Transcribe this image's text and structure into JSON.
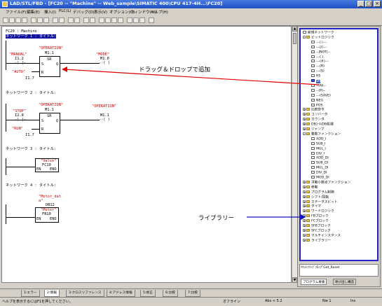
{
  "window": {
    "title": "LAD/STL/FBD - [FC20 -- \"Machine\" -- Web_sample\\SIMATIC 400\\CPU 417-4H...\\FC20]"
  },
  "menu": [
    "ファイル(F)",
    "編集(E)",
    "挿入(I)",
    "PLC(L)",
    "デバッグ(D)",
    "表示(V)",
    "オプション(O)",
    "ウィンドウ(W)",
    "ヘルプ(H)"
  ],
  "editor": {
    "block_header": "FC20 : Machine",
    "networks": [
      {
        "label": "ネットワーク 1 : タイトル:",
        "symbol_in_a": "\"MANUAL\"",
        "addr_in_a": "I1.2",
        "symbol_in_b": "\"AUTO\"",
        "addr_in_b": "I1.7",
        "sr_symbol": "\"OPERATION\"",
        "sr_addr": "M1.1",
        "sr_title": "SR",
        "pin_s": "S",
        "pin_r": "R",
        "pin_q": "Q",
        "coil_symbol": "\"MODE\"",
        "coil_addr": "M1.0"
      },
      {
        "label": "ネットワーク 2 : タイトル:",
        "symbol_in_a": "\"STOP\"",
        "addr_in_a": "I2.0",
        "symbol_in_b": "\"RUN\"",
        "addr_in_b": "I1.7",
        "sr_symbol": "\"OPERATION\"",
        "sr_addr": "M1.1",
        "sr_title": "SR",
        "pin_s": "S",
        "pin_r": "R",
        "pin_q": "Q",
        "coil_symbol": "\"OPERATION\"",
        "coil_addr": "M1.1"
      },
      {
        "label": "ネットワーク 3 : タイトル:",
        "block_symbol": "\"Valve\"",
        "block_name": "FC10",
        "pin_en": "EN",
        "pin_eno": "ENO"
      },
      {
        "label": "ネットワーク 4 : タイトル:",
        "block_symbol": "\"Motor_dat\na\"",
        "block_db": "DB12",
        "block_fb_symbol": "\"Motor\"",
        "block_name": "FB10",
        "pin_en": "EN",
        "pin_eno": "ENO"
      }
    ]
  },
  "annotations": {
    "drag_drop": "ドラッグ＆ドロップで追加",
    "library": "ライブラリー"
  },
  "catalog": {
    "tree": [
      {
        "label": "新規ネットワーク",
        "level": 0,
        "icon": "item"
      },
      {
        "label": "ビットロジック",
        "level": 0,
        "icon": "folder",
        "expand": "-"
      },
      {
        "label": "---| |---",
        "level": 1,
        "icon": "item"
      },
      {
        "label": "---|/|---",
        "level": 1,
        "icon": "item"
      },
      {
        "label": "--|NOT|--",
        "level": 1,
        "icon": "item"
      },
      {
        "label": "---( )",
        "level": 1,
        "icon": "item"
      },
      {
        "label": "---(#)---",
        "level": 1,
        "icon": "item"
      },
      {
        "label": "---(R)",
        "level": 1,
        "icon": "item"
      },
      {
        "label": "---(S)",
        "level": 1,
        "icon": "item"
      },
      {
        "label": "RS",
        "level": 1,
        "icon": "item"
      },
      {
        "label": "SR",
        "level": 1,
        "icon": "sel",
        "selected": true
      },
      {
        "label": "--(N)--",
        "level": 1,
        "icon": "item"
      },
      {
        "label": "--(P)--",
        "level": 1,
        "icon": "item"
      },
      {
        "label": "---(SAVE)",
        "level": 1,
        "icon": "item"
      },
      {
        "label": "NEG",
        "level": 1,
        "icon": "item"
      },
      {
        "label": "POS",
        "level": 1,
        "icon": "item"
      },
      {
        "label": "比較命令",
        "level": 0,
        "icon": "folder",
        "expand": "+"
      },
      {
        "label": "コンバータ",
        "level": 0,
        "icon": "folder",
        "expand": "+"
      },
      {
        "label": "カウンタ",
        "level": 0,
        "icon": "folder",
        "expand": "+"
      },
      {
        "label": "DBｺｰﾙ/DB処理",
        "level": 0,
        "icon": "folder",
        "expand": "+"
      },
      {
        "label": "ジャンプ",
        "level": 0,
        "icon": "folder",
        "expand": "+"
      },
      {
        "label": "整数ファンクション",
        "level": 0,
        "icon": "folder",
        "expand": "-"
      },
      {
        "label": "ADD_I",
        "level": 1,
        "icon": "item"
      },
      {
        "label": "SUB_I",
        "level": 1,
        "icon": "item"
      },
      {
        "label": "MUL_I",
        "level": 1,
        "icon": "item"
      },
      {
        "label": "DIV_I",
        "level": 1,
        "icon": "item"
      },
      {
        "label": "ADD_DI",
        "level": 1,
        "icon": "item"
      },
      {
        "label": "SUB_DI",
        "level": 1,
        "icon": "item"
      },
      {
        "label": "MUL_DI",
        "level": 1,
        "icon": "item"
      },
      {
        "label": "DIV_DI",
        "level": 1,
        "icon": "item"
      },
      {
        "label": "MOD_DI",
        "level": 1,
        "icon": "item"
      },
      {
        "label": "浮動小数点ファンクション",
        "level": 0,
        "icon": "folder",
        "expand": "+"
      },
      {
        "label": "移動",
        "level": 0,
        "icon": "folder",
        "expand": "+"
      },
      {
        "label": "プログラム制御",
        "level": 0,
        "icon": "folder",
        "expand": "+"
      },
      {
        "label": "シフト/回転",
        "level": 0,
        "icon": "folder",
        "expand": "+"
      },
      {
        "label": "ステータスビット",
        "level": 0,
        "icon": "folder",
        "expand": "+"
      },
      {
        "label": "タイマ",
        "level": 0,
        "icon": "folder",
        "expand": "+"
      },
      {
        "label": "ワードロジック",
        "level": 0,
        "icon": "folder",
        "expand": "+"
      },
      {
        "label": "FBブロック",
        "level": 0,
        "icon": "folder",
        "expand": "+"
      },
      {
        "label": "FCブロック",
        "level": 0,
        "icon": "folder",
        "expand": "+"
      },
      {
        "label": "SFBブロック",
        "level": 0,
        "icon": "folder",
        "expand": "+"
      },
      {
        "label": "SFCブロック",
        "level": 0,
        "icon": "folder",
        "expand": "+"
      },
      {
        "label": "マルチインスタンス",
        "level": 0,
        "icon": "folder",
        "expand": "+"
      },
      {
        "label": "ライブラリー",
        "level": 0,
        "icon": "folder",
        "expand": "+"
      }
    ],
    "status_text": "ﾘｾｯﾄﾌﾘｯﾌﾟﾌﾛｯﾌﾟGet_Reset",
    "tabs": [
      "プログラム要素",
      "呼び出し構造"
    ]
  },
  "doc_tabs": [
    "1:エラー",
    "2:情報",
    "3:クロスリファレンス",
    "4:アドレス情報",
    "5:修正",
    "6:比較",
    "7:比較"
  ],
  "status": {
    "help": "ヘルプを表示するにはF1を押してください。",
    "mode": "オフライン",
    "abs": "Abs < 5.2",
    "nw": "Nw 1",
    "ins": "Ins"
  },
  "colors": {
    "title_bar": "#1d4fc4",
    "arrow": "#e00000",
    "library_arrow": "#1010c0",
    "selection": "#3060d0",
    "symbol_text": "#c00000"
  }
}
